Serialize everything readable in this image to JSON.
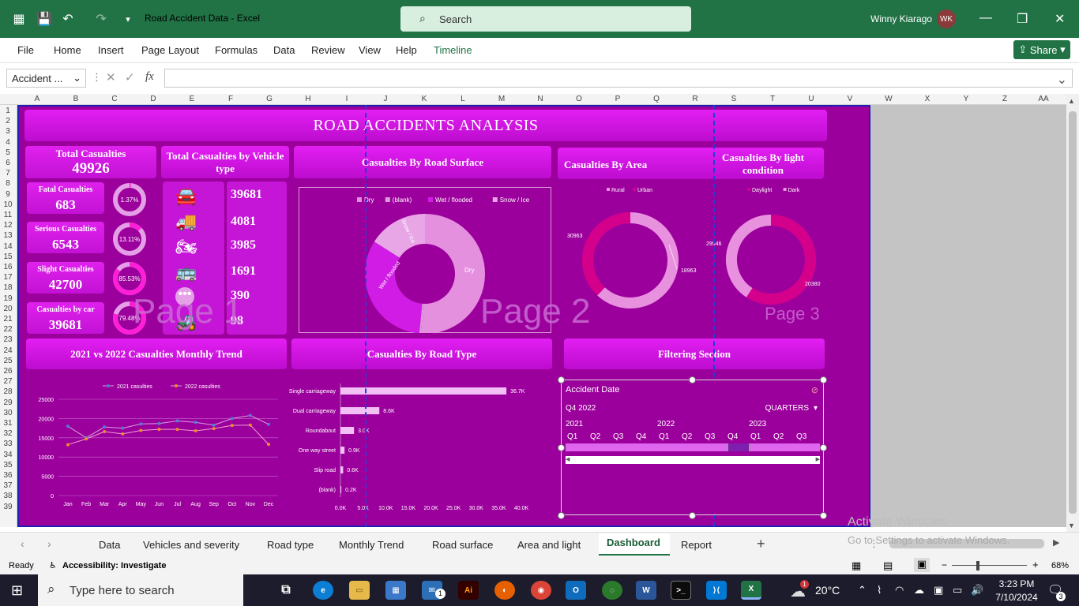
{
  "window": {
    "title": "Road Accident Data  -  Excel",
    "search_placeholder": "Search",
    "user_name": "Winny Kiarago",
    "user_initials": "WK"
  },
  "ribbon": {
    "tabs": [
      "File",
      "Home",
      "Insert",
      "Page Layout",
      "Formulas",
      "Data",
      "Review",
      "View",
      "Help",
      "Timeline"
    ],
    "share": "Share"
  },
  "formula_bar": {
    "name_box": "Accident ...",
    "fx": "fx"
  },
  "columns": [
    "A",
    "B",
    "C",
    "D",
    "E",
    "F",
    "G",
    "H",
    "I",
    "J",
    "K",
    "L",
    "M",
    "N",
    "O",
    "P",
    "Q",
    "R",
    "S",
    "T",
    "U",
    "V",
    "W",
    "X",
    "Y",
    "Z",
    "AA"
  ],
  "rows": [
    "1",
    "2",
    "3",
    "4",
    "5",
    "6",
    "7",
    "8",
    "9",
    "10",
    "11",
    "12",
    "13",
    "14",
    "15",
    "16",
    "17",
    "18",
    "19",
    "20",
    "21",
    "22",
    "23",
    "24",
    "25",
    "26",
    "27",
    "28",
    "29",
    "30",
    "31",
    "32",
    "33",
    "34",
    "35",
    "36",
    "37",
    "38",
    "39"
  ],
  "dashboard": {
    "title": "ROAD ACCIDENTS ANALYSIS",
    "total_label": "Total Casualties",
    "total_value": "49926",
    "vehicle_heading": "Total Casualties by Vehicle type",
    "road_surface_heading": "Casualties By Road Surface",
    "area_heading": "Casualties By Area",
    "light_heading": "Casualties By light condition",
    "monthly_heading": "2021 vs 2022 Casualties Monthly Trend",
    "road_type_heading": "Casualties By Road Type",
    "filter_heading": "Filtering Section",
    "kpis": [
      {
        "label": "Fatal Casualties",
        "value": "683",
        "pct": "1.37%",
        "frac": 0.0137
      },
      {
        "label": "Serious Casualties",
        "value": "6543",
        "pct": "13.11%",
        "frac": 0.1311
      },
      {
        "label": "Slight Casualties",
        "value": "42700",
        "pct": "85.53%",
        "frac": 0.8553
      },
      {
        "label": "Casualties by car",
        "value": "39681",
        "pct": "79.48%",
        "frac": 0.7948
      }
    ],
    "vehicle_values": [
      "39681",
      "4081",
      "3985",
      "1691",
      "390",
      "98"
    ],
    "vehicle_icons": [
      "car-icon",
      "truck-icon",
      "motorcycle-icon",
      "bus-icon",
      "other-vehicle-icon",
      "tractor-icon"
    ],
    "watermarks": [
      "Page 1",
      "Page 2",
      "Page 3"
    ]
  },
  "chart_data": [
    {
      "type": "pie",
      "title": "Casualties By Road Surface",
      "legend": [
        "Dry",
        "(blank)",
        "Wet / flooded",
        "Snow / Ice"
      ],
      "slice_labels": [
        "Dry",
        "Wet / flooded",
        "Snow / Ice"
      ],
      "values": [
        0.51,
        0.005,
        0.325,
        0.16
      ],
      "colors": [
        "#e58fdf",
        "#d8a0d8",
        "#d11ce6",
        "#e8a6e6"
      ],
      "legend_position": "top"
    },
    {
      "type": "pie",
      "title": "Casualties By Area",
      "legend": [
        "Rural",
        "Urban"
      ],
      "values": [
        30963,
        18963
      ],
      "labels": [
        "30963",
        "18963"
      ],
      "colors": [
        "#e891df",
        "#d4008c"
      ],
      "legend_position": "top"
    },
    {
      "type": "pie",
      "title": "Casualties By light condition",
      "legend": [
        "Daylight",
        "Dark"
      ],
      "values": [
        29546,
        20380
      ],
      "labels": [
        "29546",
        "20380"
      ],
      "colors": [
        "#d4008c",
        "#e891df"
      ],
      "legend_position": "top"
    },
    {
      "type": "line",
      "title": "2021 vs 2022 Casualties Monthly Trend",
      "categories": [
        "Jan",
        "Feb",
        "Mar",
        "Apr",
        "May",
        "Jun",
        "Jul",
        "Aug",
        "Sep",
        "Oct",
        "Nov",
        "Dec"
      ],
      "series": [
        {
          "name": "2021 casulties",
          "values": [
            18000,
            15000,
            17800,
            17500,
            18600,
            18700,
            19400,
            19000,
            18300,
            20000,
            20800,
            18500
          ],
          "color": "#4f7dd9"
        },
        {
          "name": "2022 casulties",
          "values": [
            13200,
            14700,
            16600,
            16000,
            16900,
            17200,
            17200,
            16800,
            17400,
            18200,
            18300,
            13300
          ],
          "color": "#f08a2c"
        }
      ],
      "yticks": [
        "0",
        "5000",
        "10000",
        "15000",
        "20000",
        "25000"
      ],
      "ylim": [
        0,
        25000
      ],
      "legend_position": "top"
    },
    {
      "type": "bar",
      "title": "Casualties By Road Type",
      "categories": [
        "Single carriageway",
        "Dual carriageway",
        "Roundabout",
        "One way street",
        "Slip road",
        "(blank)"
      ],
      "values": [
        36.7,
        8.6,
        3.0,
        0.9,
        0.6,
        0.2
      ],
      "labels": [
        "36.7K",
        "8.6K",
        "3.0K",
        "0.9K",
        "0.6K",
        "0.2K"
      ],
      "xticks": [
        "0.0K",
        "5.0K",
        "10.0K",
        "15.0K",
        "20.0K",
        "25.0K",
        "30.0K",
        "35.0K",
        "40.0K"
      ],
      "xlim": [
        0,
        40
      ]
    }
  ],
  "slicer": {
    "title": "Accident Date",
    "selection": "Q4 2022",
    "level": "QUARTERS",
    "years": [
      "2021",
      "2022",
      "2023"
    ],
    "quarters": [
      "Q1",
      "Q2",
      "Q3",
      "Q4",
      "Q1",
      "Q2",
      "Q3",
      "Q4",
      "Q1",
      "Q2",
      "Q3"
    ]
  },
  "sheet_tabs": [
    "Data",
    "Vehicles and severity",
    "Road type",
    "Monthly Trend",
    "Road surface",
    "Area and light",
    "Dashboard",
    "Report"
  ],
  "active_tab": "Dashboard",
  "status": {
    "ready": "Ready",
    "accessibility": "Accessibility: Investigate",
    "zoom": "68%"
  },
  "activate": {
    "line1": "Activate Windows",
    "line2": "Go to Settings to activate Windows."
  },
  "taskbar": {
    "search_placeholder": "Type here to search",
    "temp": "20°C",
    "time": "3:23 PM",
    "date": "7/10/2024",
    "notif": "3",
    "outlook_badge": "1",
    "weather_badge": "1"
  }
}
